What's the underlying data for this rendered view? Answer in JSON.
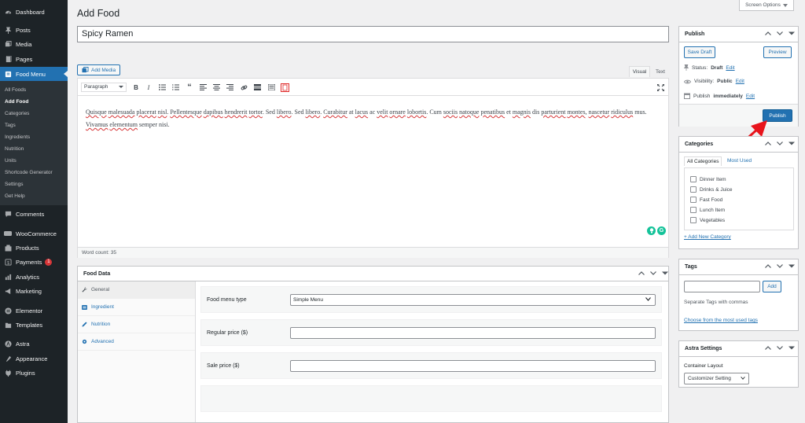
{
  "sidebar": {
    "items": [
      {
        "label": "Dashboard",
        "icon": "dashboard-icon"
      },
      {
        "label": "Posts",
        "icon": "pin-icon"
      },
      {
        "label": "Media",
        "icon": "media-icon"
      },
      {
        "label": "Pages",
        "icon": "pages-icon"
      },
      {
        "label": "Food Menu",
        "icon": "food-menu-icon"
      },
      {
        "label": "Comments",
        "icon": "comments-icon"
      },
      {
        "label": "WooCommerce",
        "icon": "woocommerce-icon"
      },
      {
        "label": "Products",
        "icon": "products-icon"
      },
      {
        "label": "Payments",
        "icon": "payments-icon",
        "badge": "1"
      },
      {
        "label": "Analytics",
        "icon": "analytics-icon"
      },
      {
        "label": "Marketing",
        "icon": "marketing-icon"
      },
      {
        "label": "Elementor",
        "icon": "elementor-icon"
      },
      {
        "label": "Templates",
        "icon": "templates-icon"
      },
      {
        "label": "Astra",
        "icon": "astra-icon"
      },
      {
        "label": "Appearance",
        "icon": "appearance-icon"
      },
      {
        "label": "Plugins",
        "icon": "plugins-icon"
      }
    ],
    "submenu": [
      "All Foods",
      "Add Food",
      "Categories",
      "Tags",
      "Ingredients",
      "Nutrition",
      "Units",
      "Shortcode Generator",
      "Settings",
      "Get Help"
    ]
  },
  "header": {
    "title": "Add Food",
    "screen_options": "Screen Options"
  },
  "post": {
    "title": "Spicy Ramen"
  },
  "editor": {
    "add_media": "Add Media",
    "tab_visual": "Visual",
    "tab_text": "Text",
    "format": "Paragraph",
    "word_count": "Word count: 35",
    "content": [
      {
        "t": "Quisque",
        "s": true
      },
      {
        "t": " "
      },
      {
        "t": "malesuada",
        "s": true
      },
      {
        "t": " "
      },
      {
        "t": "placerat",
        "s": true
      },
      {
        "t": " "
      },
      {
        "t": "nisl",
        "s": true
      },
      {
        "t": ". "
      },
      {
        "t": "Pellentesque",
        "s": true
      },
      {
        "t": " "
      },
      {
        "t": "dapibus",
        "s": true
      },
      {
        "t": " "
      },
      {
        "t": "hendrerit",
        "s": true
      },
      {
        "t": " "
      },
      {
        "t": "tortor",
        "s": true
      },
      {
        "t": ". Sed "
      },
      {
        "t": "libero",
        "s": true
      },
      {
        "t": ". Sed "
      },
      {
        "t": "libero",
        "s": true
      },
      {
        "t": ". "
      },
      {
        "t": "Curabitur",
        "s": true
      },
      {
        "t": " at "
      },
      {
        "t": "lacus",
        "s": true
      },
      {
        "t": " ac "
      },
      {
        "t": "velit",
        "s": true
      },
      {
        "t": " "
      },
      {
        "t": "ornare",
        "s": true
      },
      {
        "t": " "
      },
      {
        "t": "lobortis",
        "s": true
      },
      {
        "t": ". Cum "
      },
      {
        "t": "sociis",
        "s": true
      },
      {
        "t": " "
      },
      {
        "t": "natoque",
        "s": true
      },
      {
        "t": " "
      },
      {
        "t": "penatibus",
        "s": true
      },
      {
        "t": " et "
      },
      {
        "t": "magnis",
        "s": true
      },
      {
        "t": " dis "
      },
      {
        "t": "parturient",
        "s": true
      },
      {
        "t": " "
      },
      {
        "t": "montes",
        "s": true
      },
      {
        "t": ", "
      },
      {
        "t": "nascetur",
        "s": true
      },
      {
        "t": " "
      },
      {
        "t": "ridiculus",
        "s": true
      },
      {
        "t": " mus. "
      },
      {
        "t": "Vivamus",
        "s": true
      },
      {
        "t": " "
      },
      {
        "t": "elementum",
        "s": true
      },
      {
        "t": " semper nisi."
      }
    ]
  },
  "food_data": {
    "title": "Food Data",
    "tabs": [
      {
        "label": "General",
        "icon": "wrench-icon"
      },
      {
        "label": "Ingredient",
        "icon": "ingredient-icon"
      },
      {
        "label": "Nutrition",
        "icon": "nutrition-icon"
      },
      {
        "label": "Advanced",
        "icon": "gear-icon"
      }
    ],
    "type_label": "Food menu type",
    "type_value": "Simple Menu",
    "regular_price_label": "Regular price ($)",
    "regular_price_value": "",
    "sale_price_label": "Sale price ($)",
    "sale_price_value": ""
  },
  "publish": {
    "title": "Publish",
    "save_draft": "Save Draft",
    "preview": "Preview",
    "status_label": "Status:",
    "status_value": "Draft",
    "edit": "Edit",
    "visibility_label": "Visibility:",
    "visibility_value": "Public",
    "publish_label": "Publish",
    "publish_value": "immediately",
    "publish_button": "Publish"
  },
  "categories": {
    "title": "Categories",
    "tab_all": "All Categories",
    "tab_most": "Most Used",
    "items": [
      "Dinner Item",
      "Drinks & Juice",
      "Fast Food",
      "Lunch Item",
      "Vegetables"
    ],
    "add_new": "+ Add New Category"
  },
  "tags": {
    "title": "Tags",
    "add": "Add",
    "hint": "Separate Tags with commas",
    "choose": "Choose from the most used tags"
  },
  "astra": {
    "title": "Astra Settings",
    "container_label": "Container Layout",
    "container_value": "Customizer Setting"
  },
  "colors": {
    "sidebar_bg": "#1d2327",
    "accent": "#2271b1",
    "annotation_arrow": "#e8141c"
  }
}
